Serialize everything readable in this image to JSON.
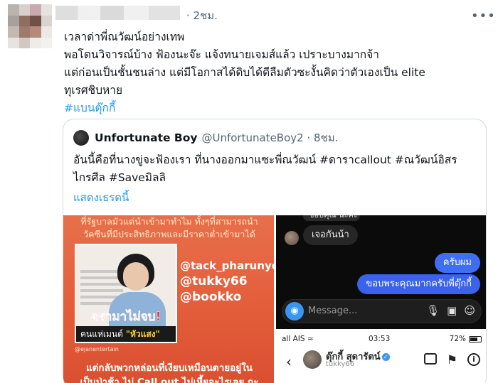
{
  "tweet": {
    "timestamp": "· 2ชม.",
    "more_icon": "more-horizontal-icon",
    "lines": [
      "เวลาด่าพี่ณวัฒน์อย่างเทพ",
      "พอโดนวิจารณ์บ้าง ฟ้องนะจ๊ะ แจ้งทนายเจมส์แล้ว เปราะบางมากจ้า",
      "แต่ก่อนเป็นชั้นชนล่าง แต่มีโอกาสได้ดิบได้ดีลืมตัวซะงั้นคิดว่าตัวเองเป็น elite",
      "ทุเรศชิบหาย"
    ],
    "hashtag": "#แบนตุ๊กกี้"
  },
  "quote": {
    "name": "Unfortunate Boy",
    "handle": "@UnfortunateBoy2 · 8ชม.",
    "lines": [
      "อันนี้คือที่นางขู่จะฟ้องเรา ที่นางออกมาแซะพี่ณวัฒน์ #ดาราcallout #ณวัฒน์อิสร",
      "ไกรศีล #Saveมิลลิ"
    ],
    "show_thread": "แสดงเธรดนี้"
  },
  "media_left": {
    "top_lines": [
      "ที่รัฐบาลมัวแต่นำเข้ามาทำไม ทั้งๆที่สามารถนำ",
      "วัคซีนที่มีประสิทธิภาพและมีราคาต่ำเข้ามาได้"
    ],
    "handles": [
      "@tack_pharunyoo",
      "@tukky66",
      "@bookko"
    ],
    "banner": "ดรามาไม่จบ!",
    "comment_prefix": "คนแห่เมนต์",
    "comment_highlight": "\"หัวแสง\"",
    "credit": "@ejanentertain",
    "bottom_lines": [
      "แต่กลับพวกหล่อนที่เงียบเหมือนตายอยู่ใน",
      "เป็นป่าช้า ไม่ Call out ไม่เหี้ยอะไรเลย กะ"
    ]
  },
  "media_right": {
    "dm": {
      "fragment": "ขอบคุณ นะคะ",
      "received": "เจอกันน้า",
      "sent_1": "ครับผม",
      "sent_2": "ขอบพระคุณมากครับพี่ตุ๊กกี้",
      "placeholder": "Message...",
      "camera_icon": "camera-icon",
      "composer_icons": [
        "microphone-icon",
        "image-icon",
        "sticker-icon"
      ]
    },
    "status": {
      "carrier": "all AIS ≈",
      "clock": "03:53",
      "battery": "72%",
      "battery_level": 0.72
    },
    "profile": {
      "name": "ตุ๊กกี้ สุดารัตน์",
      "handle": "tukky66",
      "action_icons": [
        "video-call-icon",
        "flag-icon",
        "info-icon"
      ]
    }
  },
  "colors": {
    "link_blue": "#1d9bf0",
    "secondary_text": "#536471",
    "border": "#cfd9de",
    "orange_panel": "#e35d3a",
    "dm_bubble_blue": "#3f6ef2"
  }
}
